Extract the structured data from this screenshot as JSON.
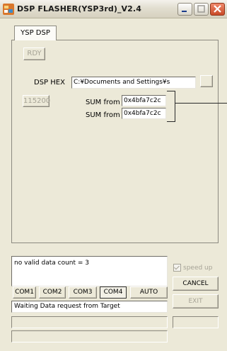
{
  "window": {
    "title": "DSP FLASHER(YSP3rd)_V2.4",
    "accent_close": "#d04e2c"
  },
  "tab": {
    "label": "YSP DSP"
  },
  "panel": {
    "ready_label": "RDY",
    "dsp_hex_label": "DSP HEX",
    "dsp_hex_value": "C:¥Documents and Settings¥s",
    "baud_label": "115200",
    "sum1_label": "SUM from",
    "sum1_value": "0x4bfa7c2c",
    "sum2_label": "SUM from",
    "sum2_value": "0x4bfa7c2c"
  },
  "message": "no valid data count = 3",
  "speedup_label": "speed up",
  "speedup_checked": true,
  "cancel_label": "CANCEL",
  "exit_label": "EXIT",
  "com_ports": [
    "COM1",
    "COM2",
    "COM3",
    "COM4"
  ],
  "auto_label": "AUTO",
  "selected_port": "COM4",
  "status": "Waiting Data request from Target"
}
